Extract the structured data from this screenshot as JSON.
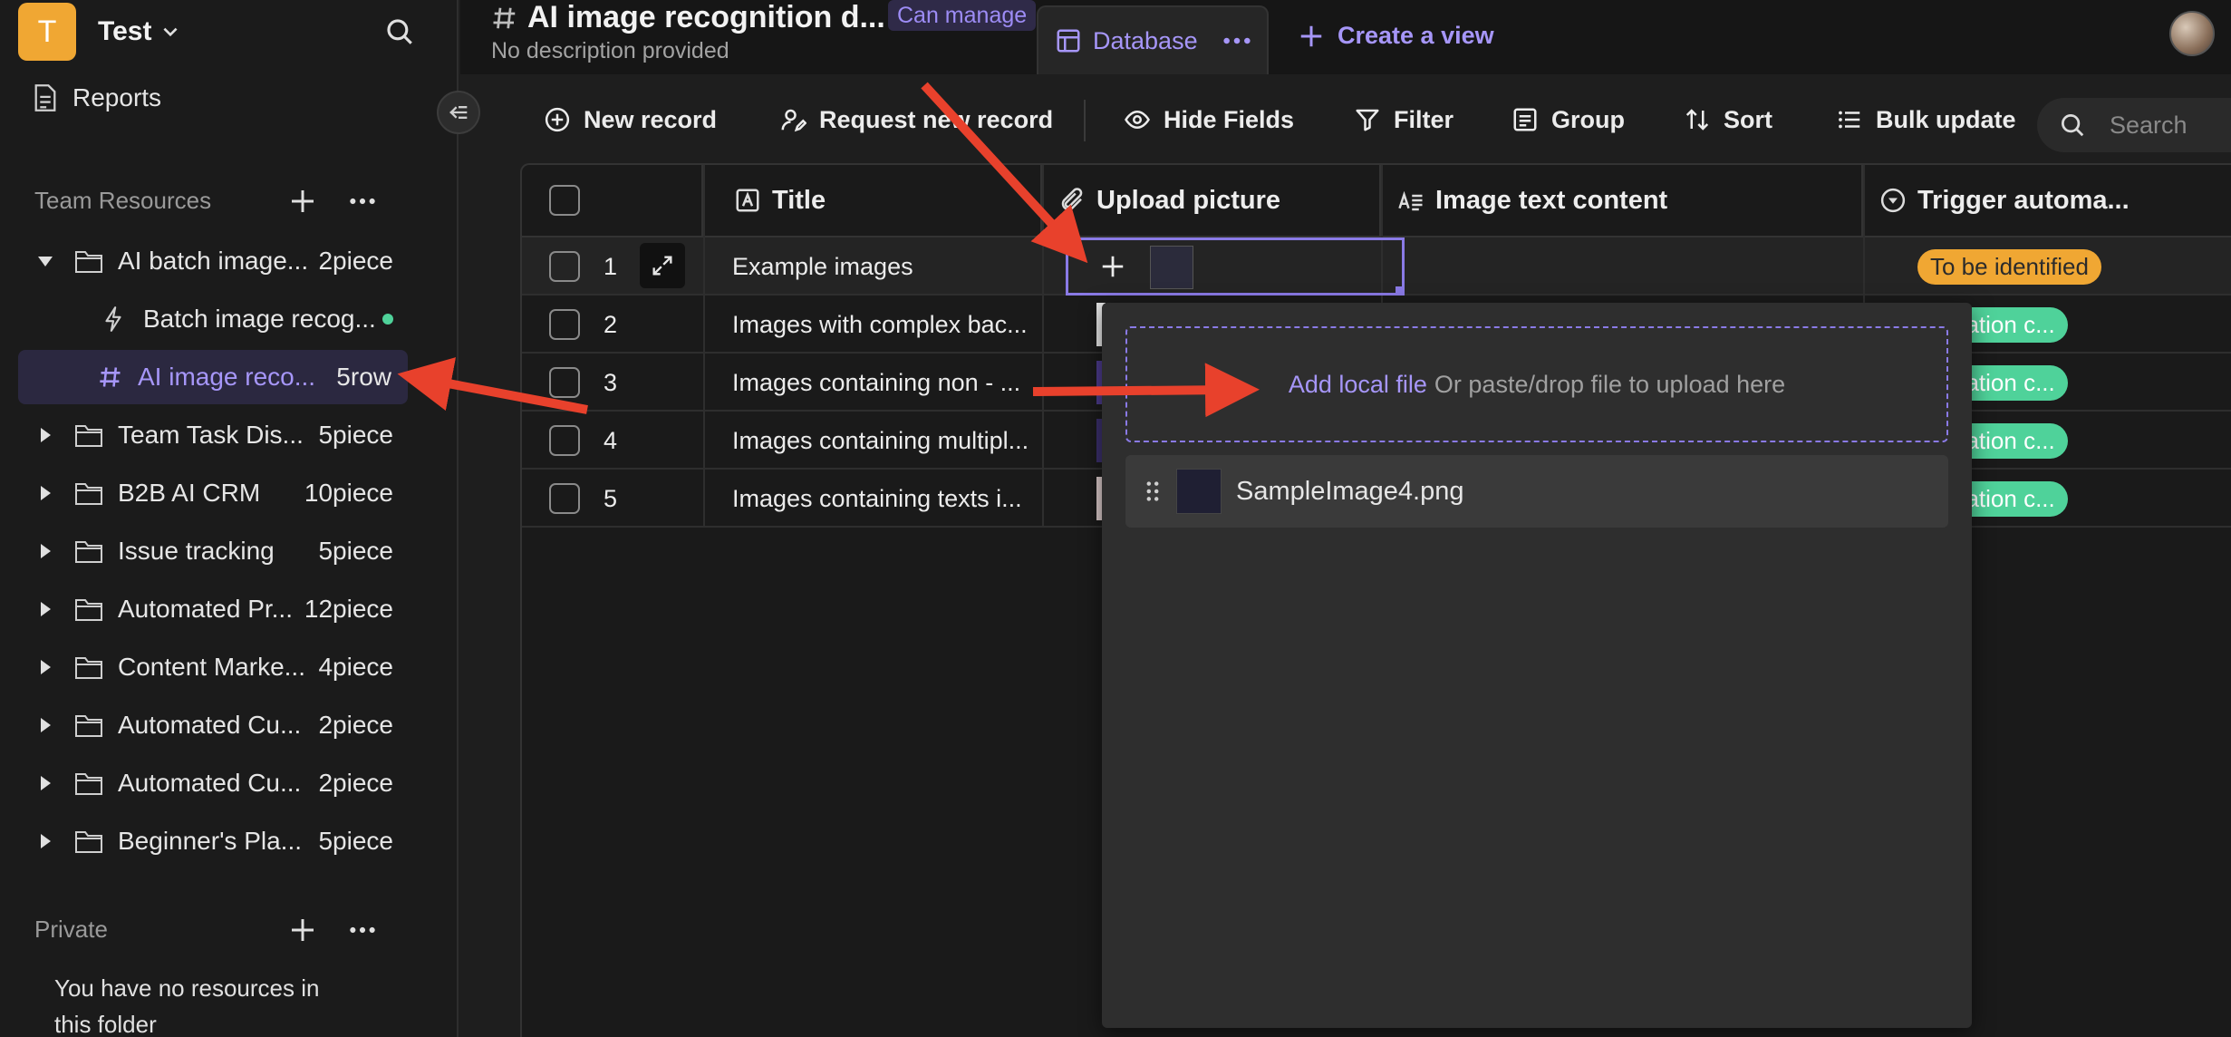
{
  "workspace": {
    "initial": "T",
    "name": "Test"
  },
  "sidebar": {
    "reports_label": "Reports",
    "team_section": "Team Resources",
    "team_items": [
      {
        "label": "AI batch image...",
        "count": "2piece",
        "expanded": true
      },
      {
        "label": "Batch image recog...",
        "count": ""
      },
      {
        "label": "AI image reco...",
        "count": "5row"
      },
      {
        "label": "Team Task Dis...",
        "count": "5piece"
      },
      {
        "label": "B2B AI CRM",
        "count": "10piece"
      },
      {
        "label": "Issue tracking",
        "count": "5piece"
      },
      {
        "label": "Automated Pr...",
        "count": "12piece"
      },
      {
        "label": "Content Marke...",
        "count": "4piece"
      },
      {
        "label": "Automated Cu...",
        "count": "2piece"
      },
      {
        "label": "Automated Cu...",
        "count": "2piece"
      },
      {
        "label": "Beginner's Pla...",
        "count": "5piece"
      }
    ],
    "private_section": "Private",
    "private_empty": "You have no resources in this folder"
  },
  "header": {
    "title": "AI image recognition d...",
    "permission": "Can manage",
    "description": "No description provided",
    "tab_label": "Database",
    "create_view": "Create a view"
  },
  "toolbar": {
    "new_record": "New record",
    "request_new_record": "Request new record",
    "hide_fields": "Hide Fields",
    "filter": "Filter",
    "group": "Group",
    "sort": "Sort",
    "bulk_update": "Bulk update",
    "search_placeholder": "Search"
  },
  "table": {
    "columns": [
      "Title",
      "Upload picture",
      "Image text content",
      "Trigger automa..."
    ],
    "rows": [
      {
        "num": "1",
        "title": "Example images",
        "status": "To be identified"
      },
      {
        "num": "2",
        "title": "Images with complex bac...",
        "status": "ntification c..."
      },
      {
        "num": "3",
        "title": "Images containing non - ...",
        "status": "ntification c..."
      },
      {
        "num": "4",
        "title": "Images containing multipl...",
        "status": "ntification c..."
      },
      {
        "num": "5",
        "title": "Images containing texts i...",
        "status": "ntification c..."
      }
    ]
  },
  "upload_popup": {
    "add_local": "Add local file",
    "drop_hint": "Or paste/drop file to upload here",
    "file_name": "SampleImage4.png"
  },
  "colors": {
    "accent": "#8a7ae6",
    "workspace_avatar": "#f0a733",
    "tag_yellow": "#f0a733",
    "tag_green": "#4fd29a",
    "arrow": "#e8412c"
  }
}
